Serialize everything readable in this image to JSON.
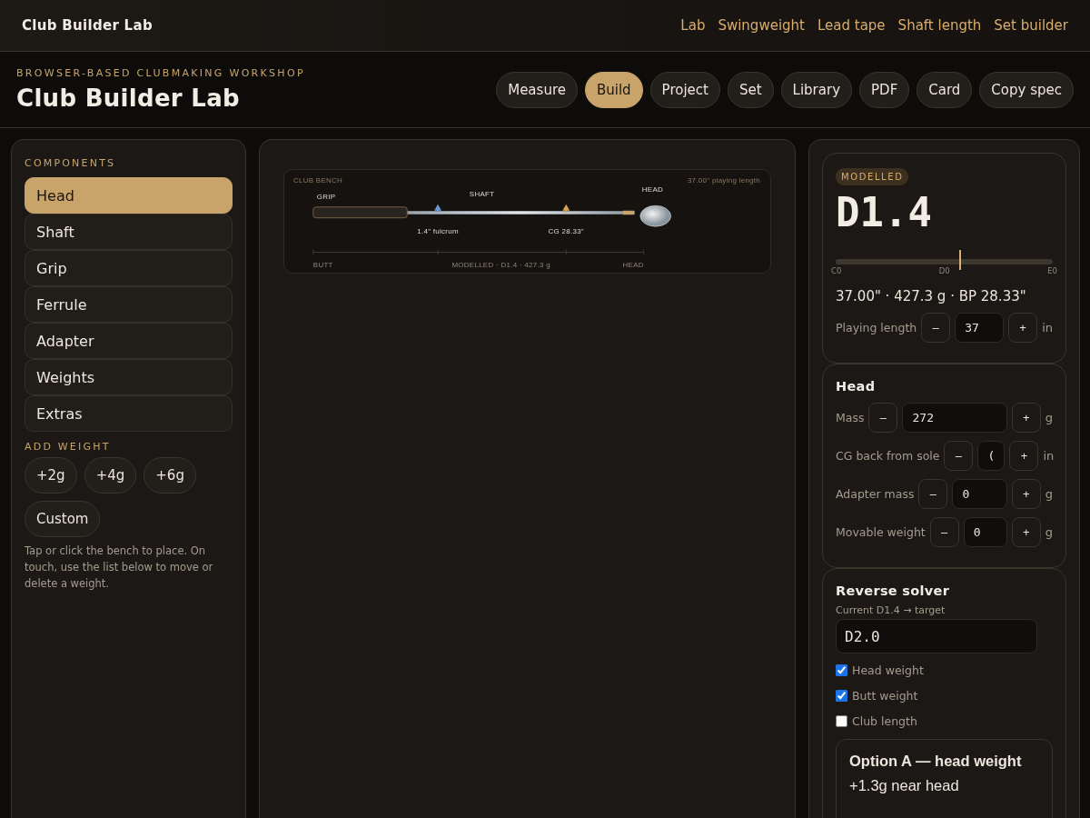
{
  "topbar": {
    "brand": "Club Builder Lab",
    "links": [
      "Lab",
      "Swingweight",
      "Lead tape",
      "Shaft length",
      "Set builder"
    ]
  },
  "header": {
    "eyebrow": "BROWSER-BASED CLUBMAKING WORKSHOP",
    "title": "Club Builder Lab",
    "actions": [
      {
        "label": "Measure",
        "selected": false
      },
      {
        "label": "Build",
        "selected": true
      },
      {
        "label": "Project",
        "selected": false
      },
      {
        "label": "Set",
        "selected": false
      },
      {
        "label": "Library",
        "selected": false
      },
      {
        "label": "PDF",
        "selected": false
      },
      {
        "label": "Card",
        "selected": false
      },
      {
        "label": "Copy spec",
        "selected": false
      }
    ]
  },
  "components": {
    "heading": "COMPONENTS",
    "items": [
      {
        "label": "Head",
        "selected": true
      },
      {
        "label": "Shaft",
        "selected": false
      },
      {
        "label": "Grip",
        "selected": false
      },
      {
        "label": "Ferrule",
        "selected": false
      },
      {
        "label": "Adapter",
        "selected": false
      },
      {
        "label": "Weights",
        "selected": false
      },
      {
        "label": "Extras",
        "selected": false
      }
    ]
  },
  "add_weight": {
    "heading": "ADD WEIGHT",
    "buttons": [
      "+2g",
      "+4g",
      "+6g",
      "Custom"
    ],
    "note": "Tap or click the bench to place. On touch, use the list below to move or delete a weight."
  },
  "bench": {
    "title": "CLUB BENCH",
    "length_note": "37.00\" playing length",
    "parts": [
      "GRIP",
      "SHAFT",
      "HEAD"
    ],
    "markers": [
      {
        "label": "1.4\" fulcrum",
        "color": "#6a9ad8"
      },
      {
        "label": "CG 28.33\"",
        "color": "#d9a24e"
      }
    ],
    "scale": [
      "BUTT",
      "MODELLED · D1.4 · 427.3 g",
      "HEAD"
    ]
  },
  "summary": {
    "badge": "MODELLED",
    "rating": "D1.4",
    "scale": {
      "level": 0.57,
      "labels": [
        "C0",
        "D0",
        "E0"
      ]
    },
    "stats": "37.00\" · 427.3 g · BP 28.33\"",
    "length": {
      "label": "Playing length",
      "value": "37",
      "unit": "in",
      "decrement": "–",
      "increment": "+"
    }
  },
  "head": {
    "title": "Head",
    "fields": [
      {
        "label": "Mass",
        "value": "272",
        "unit": "g",
        "decrement": "–",
        "increment": "+"
      },
      {
        "label": "CG back from sole",
        "value": "(",
        "unit": "in",
        "decrement": "–",
        "increment": "+"
      },
      {
        "label": "Adapter mass",
        "value": "0",
        "unit": "g",
        "decrement": "–",
        "increment": "+"
      },
      {
        "label": "Movable weight",
        "value": "0",
        "unit": "g",
        "decrement": "–",
        "increment": "+"
      }
    ]
  },
  "solver": {
    "title": "Reverse solver",
    "hint": "Current D1.4 → target",
    "target": "D2.0",
    "options": [
      {
        "label": "Head weight",
        "checked": true
      },
      {
        "label": "Butt weight",
        "checked": true
      },
      {
        "label": "Club length",
        "checked": false
      }
    ],
    "result": {
      "title": "Option A — head weight",
      "detail": "+1.3g near head"
    }
  }
}
